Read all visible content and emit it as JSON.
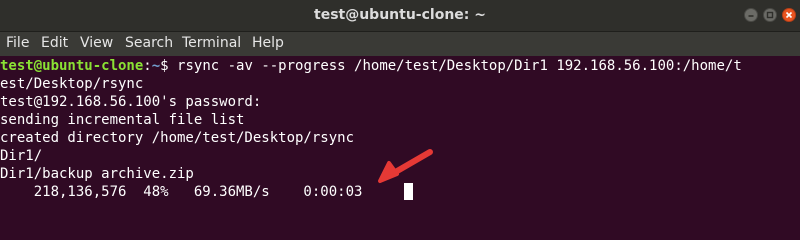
{
  "window": {
    "title": "test@ubuntu-clone: ~",
    "controls": {
      "minimize_icon": "minimize-icon",
      "maximize_icon": "maximize-icon",
      "close_icon": "close-icon"
    }
  },
  "menu": {
    "items": [
      "File",
      "Edit",
      "View",
      "Search",
      "Terminal",
      "Help"
    ]
  },
  "terminal": {
    "prompt_user": "test@ubuntu-clone",
    "prompt_sep": ":",
    "prompt_path": "~",
    "prompt_symbol": "$ ",
    "command": "rsync -av --progress /home/test/Desktop/Dir1 192.168.56.100:/home/t",
    "lines": [
      "est/Desktop/rsync",
      "test@192.168.56.100's password:",
      "sending incremental file list",
      "created directory /home/test/Desktop/rsync",
      "Dir1/",
      "Dir1/backup archive.zip",
      "    218,136,576  48%   69.36MB/s    0:00:03"
    ]
  },
  "colors": {
    "background": "#300a24",
    "prompt_user": "#8ae234",
    "prompt_path": "#729fcf",
    "arrow": "#e53935"
  },
  "progress": {
    "bytes": "218,136,576",
    "percent": "48%",
    "rate": "69.36MB/s",
    "eta": "0:00:03"
  }
}
